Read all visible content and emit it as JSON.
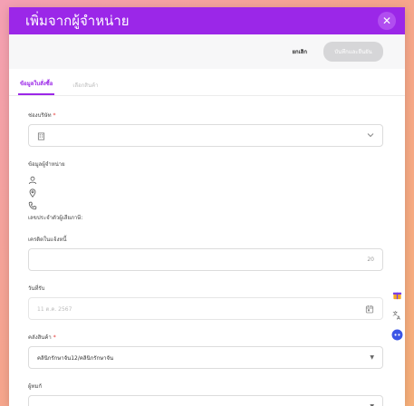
{
  "modal": {
    "title": "เพิ่มจากผู้จำหน่าย",
    "close_icon": "close-icon"
  },
  "actions": {
    "cancel_label": "ยกเลิก",
    "save_label": "บันทึกและยืนยัน"
  },
  "tabs": [
    {
      "label": "ข้อมูลใบสั่งซื้อ",
      "active": true
    },
    {
      "label": "เลือกสินค้า",
      "active": false
    }
  ],
  "form": {
    "company": {
      "label": "ช่องบริษัท",
      "required": "*",
      "value": ""
    },
    "supplier_info": {
      "label": "ข้อมูลผู้จำหน่าย",
      "tax_id_label": "เลขประจำตัวผู้เสียภาษี:"
    },
    "credit_days": {
      "label": "เครดิตในแจ้งหนี้",
      "value": "20"
    },
    "receive_date": {
      "label": "วันที่รับ",
      "value": "11 ต.ค. 2567"
    },
    "warehouse": {
      "label": "คลังสินค้า",
      "required": "*",
      "value": "คลินิกรักษาจัน12/คลินิกรักษาจัน"
    },
    "issuer": {
      "label": "ผู้ทมกั",
      "value": ""
    }
  },
  "side_icons": [
    "gift-icon",
    "translate-icon",
    "assistant-icon"
  ]
}
